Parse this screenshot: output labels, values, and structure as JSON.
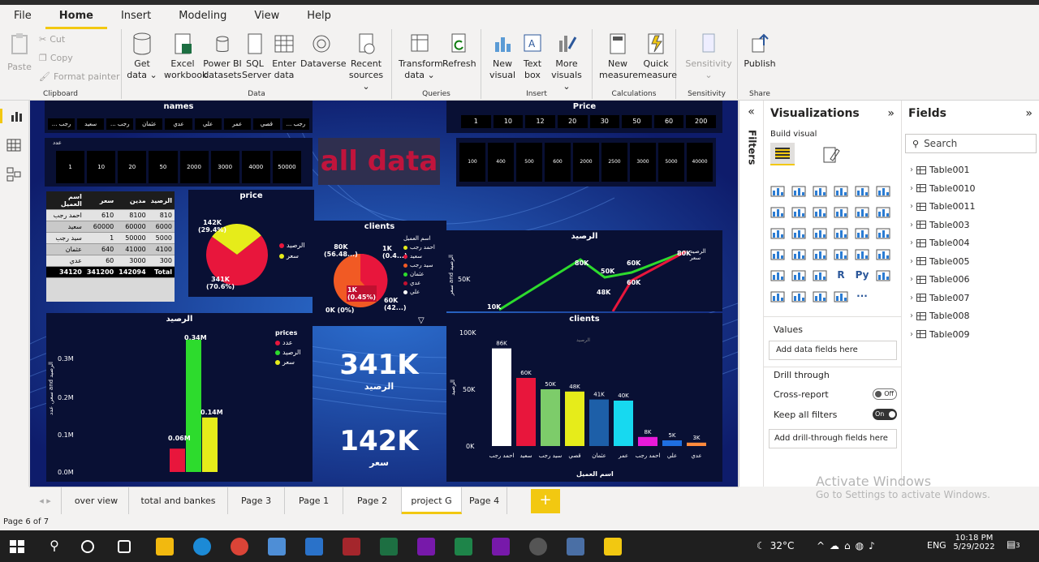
{
  "app": {
    "page_status": "Page 6 of 7"
  },
  "menu": [
    "File",
    "Home",
    "Insert",
    "Modeling",
    "View",
    "Help"
  ],
  "ribbon": {
    "clipboard": {
      "paste": "Paste",
      "cut": "Cut",
      "copy": "Copy",
      "format_painter": "Format painter",
      "label": "Clipboard"
    },
    "data": {
      "label": "Data",
      "buttons": [
        [
          "Get",
          "data ⌄"
        ],
        [
          "Excel",
          "workbook"
        ],
        [
          "Power BI",
          "datasets"
        ],
        [
          "SQL",
          "Server"
        ],
        [
          "Enter",
          "data"
        ],
        [
          "Dataverse",
          ""
        ],
        [
          "Recent",
          "sources ⌄"
        ]
      ]
    },
    "queries": {
      "label": "Queries",
      "buttons": [
        [
          "Transform",
          "data ⌄"
        ],
        [
          "Refresh",
          ""
        ]
      ]
    },
    "insert": {
      "label": "Insert",
      "buttons": [
        [
          "New",
          "visual"
        ],
        [
          "Text",
          "box"
        ],
        [
          "More",
          "visuals ⌄"
        ]
      ]
    },
    "calculations": {
      "label": "Calculations",
      "buttons": [
        [
          "New",
          "measure"
        ],
        [
          "Quick",
          "measure"
        ]
      ]
    },
    "sensitivity": {
      "label": "Sensitivity",
      "buttons": [
        [
          "Sensitivity",
          "⌄"
        ]
      ]
    },
    "share": {
      "label": "Share",
      "buttons": [
        [
          "Publish",
          ""
        ]
      ]
    }
  },
  "report": {
    "names_slicer": {
      "title": "names",
      "items": [
        "... رجب",
        "سعيد",
        "... رجب",
        "عثمان",
        "عدي",
        "علي",
        "عمر",
        "قصي",
        "... رجب"
      ]
    },
    "price_slicer": {
      "title": "Price",
      "items": [
        "1",
        "10",
        "12",
        "20",
        "30",
        "50",
        "60",
        "200"
      ]
    },
    "count_slicer": {
      "label": "عدد",
      "items": [
        "1",
        "10",
        "20",
        "50",
        "2000",
        "3000",
        "4000",
        "50000"
      ]
    },
    "right_slicer": {
      "items": [
        "100",
        "400",
        "500",
        "600",
        "2000",
        "2500",
        "3000",
        "5000",
        "40000"
      ]
    },
    "banner": "all data",
    "table": {
      "headers": [
        "اسم العميل",
        "سعر",
        "مدين",
        "الرصيد"
      ],
      "rows": [
        [
          "احمد رجب",
          "610",
          "8100",
          "810"
        ],
        [
          "سعيد",
          "60000",
          "60000",
          "6000"
        ],
        [
          "سيد رجب",
          "1",
          "50000",
          "5000"
        ],
        [
          "عثمان",
          "640",
          "41000",
          "4100"
        ],
        [
          "عدي",
          "60",
          "3000",
          "300"
        ]
      ],
      "total": [
        "Total",
        "142094",
        "341200",
        "34120"
      ]
    },
    "price_pie": {
      "title": "price",
      "l1": "142K",
      "l1b": "(29.4%)",
      "l2": "341K",
      "l2b": "(70.6%)",
      "legend": [
        "الرصيد",
        "سعر"
      ]
    },
    "clients_pie": {
      "title": "clients",
      "legend_title": "اسم العميل",
      "legend": [
        "احمد رجب",
        "سعيد",
        "سيد رجب",
        "عثمان",
        "عدي",
        "علي"
      ],
      "l1": "80K",
      "l1b": "(56.48...)",
      "l2": "1K",
      "l2b": "(0.4...)",
      "l3": "1K",
      "l3b": "(0.45%)",
      "l4": "60K",
      "l4b": "(42...)",
      "l5": "0K (0%)"
    },
    "line_chart": {
      "title": "الرصيد",
      "ylabel": "سعر and الرصيد",
      "ytick": "50K",
      "labels": [
        "10K",
        "80K",
        "50K",
        "48K",
        "60K",
        "60K",
        "80K"
      ],
      "legend": [
        "الرصيد",
        "سعر"
      ]
    },
    "bar_left": {
      "title": "الرصيد",
      "ylabel": "سعر, عدد and الرصيد",
      "legend_title": "prices",
      "legend": [
        "عدد",
        "الرصيد",
        "سعر"
      ],
      "yticks": [
        "0.3M",
        "0.2M",
        "0.1M",
        "0.0M"
      ],
      "labels": [
        "0.06M",
        "0.34M",
        "0.14M"
      ]
    },
    "card1": {
      "value": "341K",
      "label": "الرصيد"
    },
    "card2": {
      "value": "142K",
      "label": "سعر"
    },
    "bar_clients": {
      "title": "clients",
      "ylabel": "الرصيد",
      "xlabel": "اسم العميل",
      "yticks": [
        "100K",
        "50K",
        "0K"
      ],
      "sub": "الرصيد"
    }
  },
  "chart_data": [
    {
      "type": "pie",
      "title": "price",
      "categories": [
        "الرصيد",
        "سعر"
      ],
      "values": [
        341,
        142
      ]
    },
    {
      "type": "bar",
      "title": "clients",
      "xlabel": "اسم العميل",
      "ylabel": "الرصيد",
      "categories": [
        "احمد رجب",
        "سعيد",
        "سيد رجب",
        "قصي",
        "عثمان",
        "عمر",
        "احمد رجب",
        "علي",
        "عدي"
      ],
      "values": [
        86,
        60,
        50,
        48,
        41,
        40,
        8,
        5,
        3
      ],
      "ylim": [
        0,
        100
      ]
    },
    {
      "type": "bar",
      "title": "الرصيد",
      "series": [
        {
          "name": "عدد",
          "values": [
            0.06
          ]
        },
        {
          "name": "الرصيد",
          "values": [
            0.34
          ]
        },
        {
          "name": "سعر",
          "values": [
            0.14
          ]
        }
      ],
      "ylim": [
        0,
        0.35
      ]
    }
  ],
  "colors": {
    "accent": "#f2c811",
    "canvas": "#0e1c6b",
    "panel": "#0a1033"
  },
  "filters_label": "Filters",
  "viz": {
    "title": "Visualizations",
    "build": "Build visual",
    "values": "Values",
    "add_fields": "Add data fields here",
    "drill": "Drill through",
    "cross": "Cross-report",
    "cross_state": "Off",
    "keep": "Keep all filters",
    "keep_state": "On",
    "add_drill": "Add drill-through fields here"
  },
  "fields": {
    "title": "Fields",
    "search": "Search",
    "tables": [
      "Table001",
      "Table0010",
      "Table0011",
      "Table003",
      "Table004",
      "Table005",
      "Table006",
      "Table007",
      "Table008",
      "Table009"
    ]
  },
  "tabs": [
    "over view",
    "total and bankes",
    "Page 3",
    "Page 1",
    "Page 2",
    "project G",
    "Page 4"
  ],
  "watermark": {
    "l1": "Activate Windows",
    "l2": "Go to Settings to activate Windows."
  },
  "taskbar": {
    "temp": "32°C",
    "lang": "ENG",
    "time": "10:18 PM",
    "date": "5/29/2022",
    "notif": "3"
  }
}
